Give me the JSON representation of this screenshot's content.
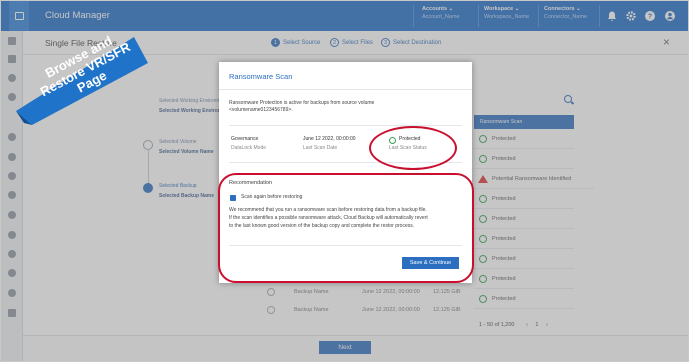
{
  "app": {
    "title": "Cloud Manager"
  },
  "topbar": {
    "accounts_label": "Accounts",
    "accounts_value": "Account_Name",
    "workspace_label": "Workspace",
    "workspace_value": "Workspace_Name",
    "connectors_label": "Connectors",
    "connectors_value": "Connector_Name"
  },
  "wizard": {
    "title": "Single File Restore",
    "steps": [
      {
        "num": "1",
        "label": "Select Source"
      },
      {
        "num": "2",
        "label": "Select Files"
      },
      {
        "num": "3",
        "label": "Select Destination"
      }
    ],
    "close": "×"
  },
  "left_steps": {
    "s1_title": "Selected Working Environment",
    "s1_value": "Selected Working Environment",
    "s2_title": "Selected Volume",
    "s2_value": "Selected Volume Name",
    "s3_title": "Selected Backup",
    "s3_value": "Selected Backup Name"
  },
  "table": {
    "header": "Ransomware Scan",
    "rows": [
      "Protected",
      "Protected",
      "Potential Ransomware Identified",
      "Protected",
      "Protected",
      "Protected",
      "Protected",
      "Protected",
      "Protected"
    ],
    "bottom_rows": [
      {
        "name": "Backup Name",
        "date": "June 12 2022, 00:00:00",
        "size": "12.125 GiB"
      },
      {
        "name": "Backup Name",
        "date": "June 12 2022, 00:00:00",
        "size": "12.125 GiB"
      }
    ],
    "pagination": "1 - 50 of 1,200",
    "page": "1"
  },
  "modal": {
    "title": "Ransomware Scan",
    "intro": "Ransomware Protection is active for backups from source volume",
    "volume": "<volumename0123456789>.",
    "governance_key": "Governance",
    "governance_val": "DataLock Mode",
    "date_key": "June 12 2022, 00:00:00",
    "date_val": "Last Scan Date",
    "status_key": "Protected",
    "status_val": "Last Scan Status",
    "rec_title": "Recommendation",
    "checkbox_label": "Scan again before restoring",
    "rec_line1": "We recommend that you run a ransomware scan before restoring data from a backup file.",
    "rec_line2": "If the scan identifies a possible ransomware attack, Cloud Backup will automatically revert",
    "rec_line3": "to the last known good version of the backup copy and complete the restor process.",
    "save_button": "Save & Continue"
  },
  "footer": {
    "next": "Next"
  },
  "banner": {
    "text": "Browse and Restore VR/SFR Page",
    "color": "#1f73c9"
  },
  "colors": {
    "primary": "#2c6fc0",
    "topbar": "#1e6bc6",
    "highlight": "#c8102e",
    "ok": "#3aa157"
  }
}
